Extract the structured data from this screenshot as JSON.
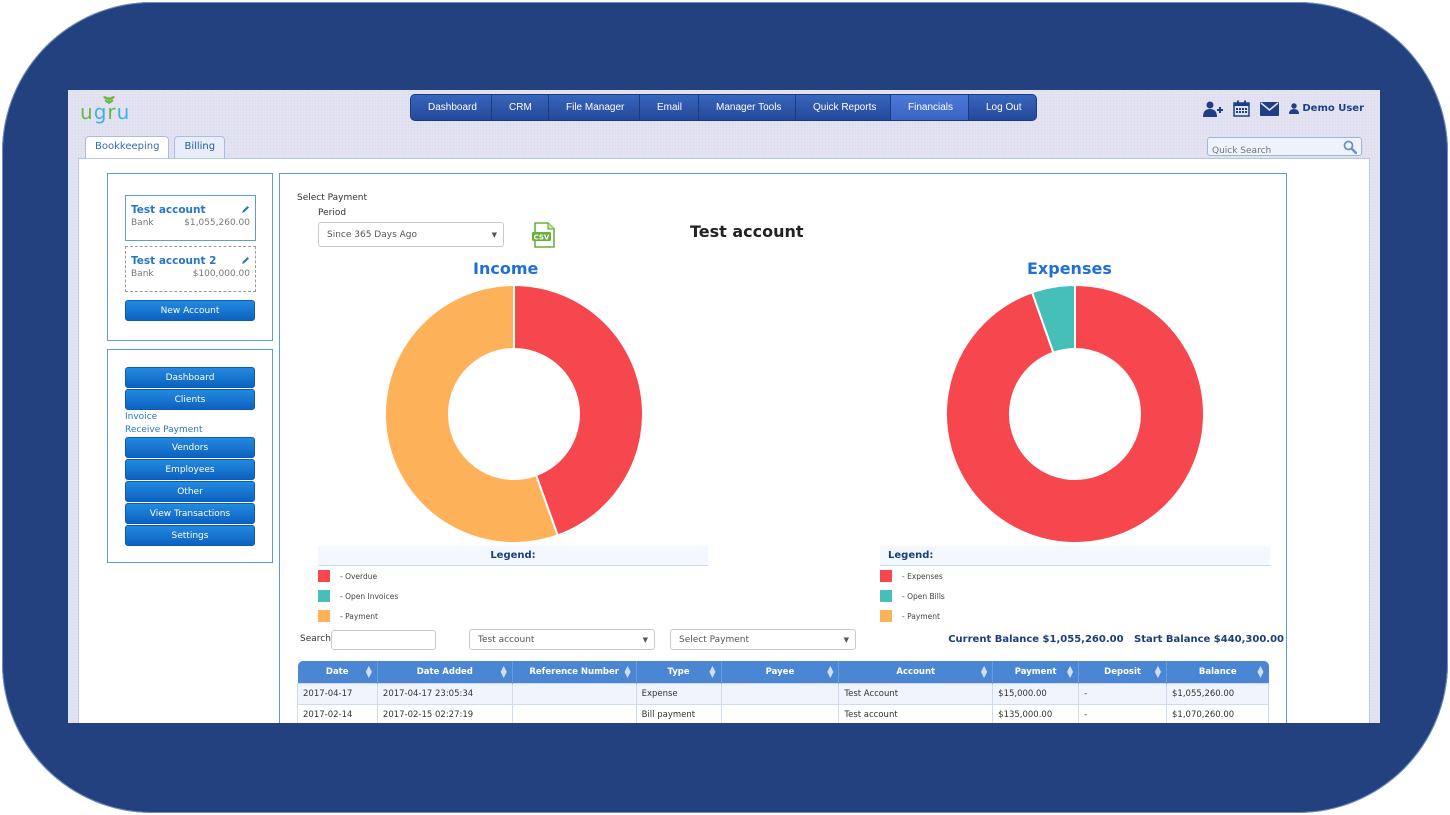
{
  "app": {
    "logo": "ugru",
    "nav": [
      {
        "label": "Dashboard",
        "active": false
      },
      {
        "label": "CRM",
        "active": false
      },
      {
        "label": "File Manager",
        "active": false
      },
      {
        "label": "Email",
        "active": false
      },
      {
        "label": "Manager Tools",
        "active": false
      },
      {
        "label": "Quick Reports",
        "active": false
      },
      {
        "label": "Financials",
        "active": true
      },
      {
        "label": "Log Out",
        "active": false
      }
    ],
    "user_tools": {
      "icons": [
        "add-user-icon",
        "calendar-icon",
        "envelope-icon",
        "user-icon"
      ],
      "user_name": "Demo User"
    },
    "tabs": [
      {
        "label": "Bookkeeping",
        "active": true
      },
      {
        "label": "Billing",
        "active": false
      }
    ],
    "quick_search": {
      "placeholder": "Quick Search",
      "value": ""
    }
  },
  "sidebar": {
    "accounts": [
      {
        "name": "Test account",
        "type": "Bank",
        "balance": "$1,055,260.00",
        "selected": true
      },
      {
        "name": "Test account 2",
        "type": "Bank",
        "balance": "$100,000.00",
        "selected": false
      }
    ],
    "new_account_label": "New Account",
    "menu": {
      "dashboard": "Dashboard",
      "clients": "Clients",
      "invoice": "Invoice",
      "receive_payment": "Receive Payment",
      "vendors": "Vendors",
      "employees": "Employees",
      "other": "Other",
      "view_transactions": "View Transactions",
      "settings": "Settings"
    }
  },
  "main": {
    "select_payment_label": "Select Payment",
    "period_label": "Period",
    "period_value": "Since 365 Days Ago",
    "export_icon": "csv-file-icon",
    "account_title": "Test account",
    "income_legend": {
      "title": "Legend:",
      "items": [
        {
          "label": "- Overdue",
          "color": "#f6464e"
        },
        {
          "label": "- Open Invoices",
          "color": "#45bfb8"
        },
        {
          "label": "- Payment",
          "color": "#fdb25a"
        }
      ]
    },
    "expenses_legend": {
      "title": "Legend:",
      "items": [
        {
          "label": "- Expenses",
          "color": "#f6464e"
        },
        {
          "label": "- Open Bills",
          "color": "#45bfb8"
        },
        {
          "label": "- Payment",
          "color": "#fdb25a"
        }
      ]
    },
    "filters": {
      "search_label": "Search:",
      "search_value": "",
      "account_select": "Test account",
      "payment_select": "Select Payment"
    },
    "current_balance": "Current Balance $1,055,260.00",
    "start_balance": "Start Balance $440,300.00",
    "table": {
      "columns": [
        "Date",
        "Date Added",
        "Reference Number",
        "Type",
        "Payee",
        "Account",
        "Payment",
        "Deposit",
        "Balance"
      ],
      "rows": [
        [
          "2017-04-17",
          "2017-04-17 23:05:34",
          "",
          "Expense",
          "",
          "Test Account",
          "$15,000.00",
          "-",
          "$1,055,260.00"
        ],
        [
          "2017-02-14",
          "2017-02-15 02:27:19",
          "",
          "Bill payment",
          "",
          "Test account",
          "$135,000.00",
          "-",
          "$1,070,260.00"
        ]
      ]
    }
  },
  "chart_data": [
    {
      "type": "pie",
      "title": "Income",
      "donut": true,
      "categories": [
        "Overdue",
        "Open Invoices",
        "Payment"
      ],
      "values": [
        44.5,
        0,
        55.5
      ],
      "colors": [
        "#f6464e",
        "#45bfb8",
        "#fdb25a"
      ],
      "unit": "percent (estimated)",
      "legend": "bottom"
    },
    {
      "type": "pie",
      "title": "Expenses",
      "donut": true,
      "categories": [
        "Expenses",
        "Open Bills",
        "Payment"
      ],
      "values": [
        94.6,
        5.4,
        0
      ],
      "colors": [
        "#f6464e",
        "#45bfb8",
        "#fdb25a"
      ],
      "unit": "percent (estimated)",
      "legend": "bottom"
    }
  ]
}
